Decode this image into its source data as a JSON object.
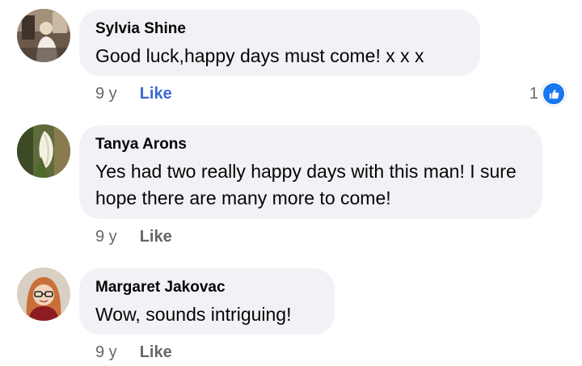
{
  "colors": {
    "bubble": "#f0f2f5",
    "like_active": "#3b6ad1",
    "meta_gray": "#65676b",
    "reaction_blue": "#1877f2"
  },
  "comments": [
    {
      "author": "Sylvia Shine",
      "text": "Good luck,happy days must come! x x x",
      "time": "9 y",
      "like_label": "Like",
      "liked": true,
      "reaction_count": "1",
      "reaction_icon": "thumbs-up-icon"
    },
    {
      "author": "Tanya Arons",
      "text": "Yes had two really happy days with this man!  I sure hope there are many more to come!",
      "time": "9 y",
      "like_label": "Like",
      "liked": false
    },
    {
      "author": "Margaret Jakovac",
      "text": "Wow, sounds intriguing!",
      "time": "9 y",
      "like_label": "Like",
      "liked": false
    }
  ]
}
